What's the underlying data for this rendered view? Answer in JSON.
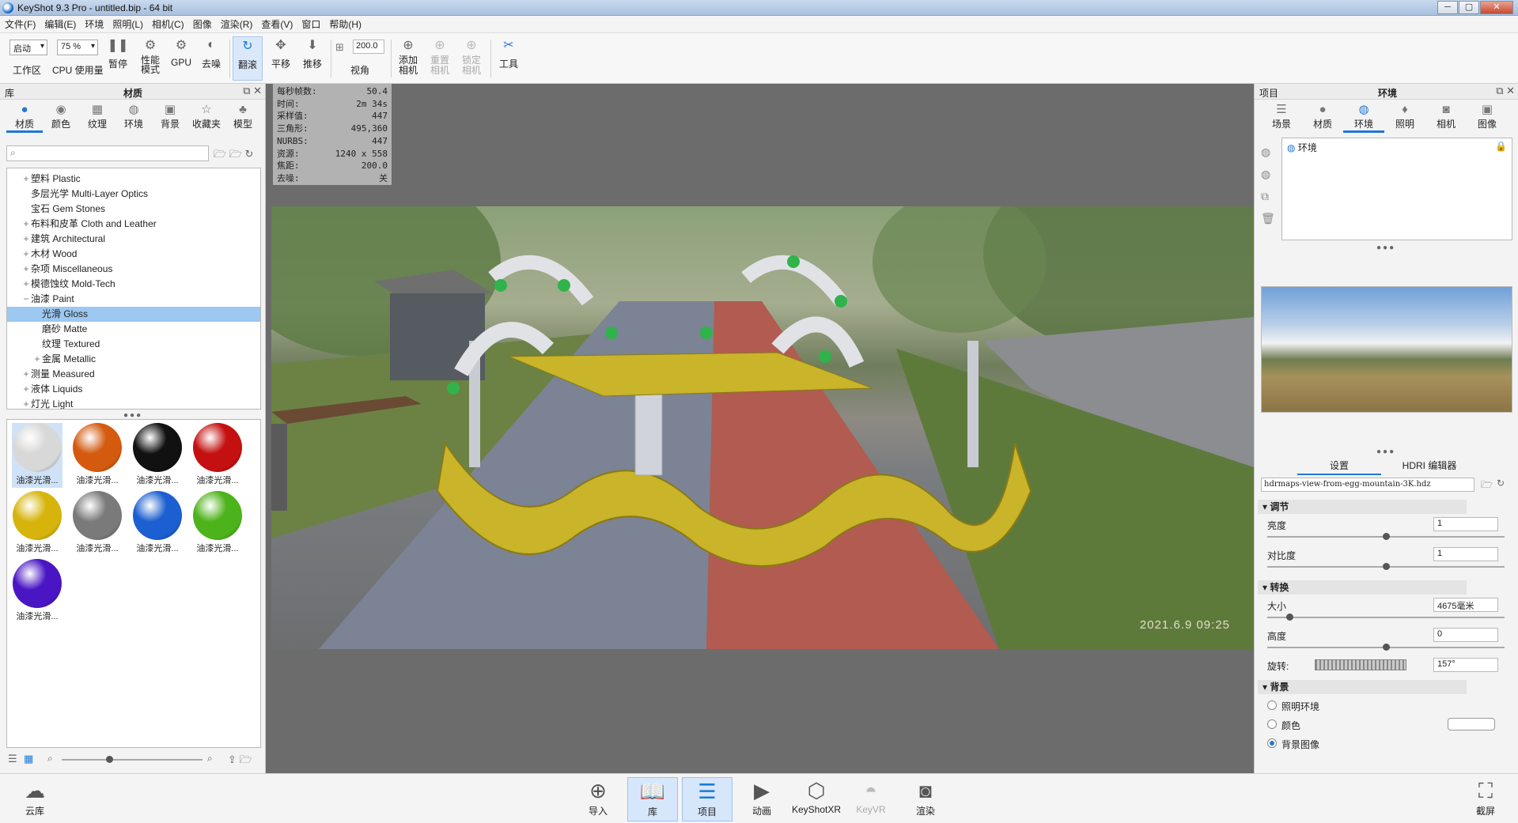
{
  "window": {
    "title": "KeyShot 9.3 Pro  - untitled.bip  - 64 bit",
    "min": "─",
    "max": "▢",
    "close": "✕"
  },
  "menu": [
    "文件(F)",
    "编辑(E)",
    "环境",
    "照明(L)",
    "相机(C)",
    "图像",
    "渲染(R)",
    "查看(V)",
    "窗口",
    "帮助(H)"
  ],
  "toolbar": {
    "workspace_select": "启动",
    "workspace_label": "工作区",
    "cpu_select": "75 %",
    "cpu_label": "CPU 使用量",
    "pause": "暂停",
    "perf": "性能\n模式",
    "gpu": "GPU",
    "denoise": "去噪",
    "tumble": "翻滚",
    "pan": "平移",
    "dolly": "推移",
    "fov_value": "200.0",
    "fov": "视角",
    "add_camera": "添加\n相机",
    "reset_camera": "重置\n相机",
    "lock_camera": "锁定\n相机",
    "tools": "工具"
  },
  "library": {
    "title_left": "库",
    "title": "材质",
    "tabs": [
      "材质",
      "颜色",
      "纹理",
      "环境",
      "背景",
      "收藏夹",
      "模型"
    ],
    "search_placeholder": "",
    "tree": [
      {
        "label": "塑料 Plastic",
        "pm": "+",
        "indent": 1
      },
      {
        "label": "多层光学 Multi-Layer Optics",
        "pm": "",
        "indent": 1
      },
      {
        "label": "宝石 Gem Stones",
        "pm": "",
        "indent": 1
      },
      {
        "label": "布料和皮革 Cloth and Leather",
        "pm": "+",
        "indent": 1
      },
      {
        "label": "建筑 Architectural",
        "pm": "+",
        "indent": 1
      },
      {
        "label": "木材 Wood",
        "pm": "+",
        "indent": 1
      },
      {
        "label": "杂项 Miscellaneous",
        "pm": "+",
        "indent": 1
      },
      {
        "label": "模德蚀纹 Mold-Tech",
        "pm": "+",
        "indent": 1
      },
      {
        "label": "油漆 Paint",
        "pm": "−",
        "indent": 1
      },
      {
        "label": "光滑 Gloss",
        "pm": "",
        "indent": 2,
        "selected": true
      },
      {
        "label": "磨砂 Matte",
        "pm": "",
        "indent": 2
      },
      {
        "label": "纹理 Textured",
        "pm": "",
        "indent": 2
      },
      {
        "label": "金属 Metallic",
        "pm": "+",
        "indent": 2
      },
      {
        "label": "测量 Measured",
        "pm": "+",
        "indent": 1
      },
      {
        "label": "液体 Liquids",
        "pm": "+",
        "indent": 1
      },
      {
        "label": "灯光 Light",
        "pm": "+",
        "indent": 1
      }
    ],
    "swatches": [
      {
        "label": "油漆光滑...",
        "color": "#d8d8d8"
      },
      {
        "label": "油漆光滑...",
        "color": "#d35a0f"
      },
      {
        "label": "油漆光滑...",
        "color": "#111111"
      },
      {
        "label": "油漆光滑...",
        "color": "#c41010"
      },
      {
        "label": "油漆光滑...",
        "color": "#d6b40c"
      },
      {
        "label": "油漆光滑...",
        "color": "#7a7a7a"
      },
      {
        "label": "油漆光滑...",
        "color": "#1c5fd0"
      },
      {
        "label": "油漆光滑...",
        "color": "#4db31a"
      },
      {
        "label": "油漆光滑...",
        "color": "#4a16c4"
      }
    ]
  },
  "stats": [
    [
      "每秒帧数:",
      "50.4"
    ],
    [
      "时间:",
      "2m 34s"
    ],
    [
      "采样值:",
      "447"
    ],
    [
      "三角形:",
      "495,360"
    ],
    [
      "NURBS:",
      "447"
    ],
    [
      "资源:",
      "1240 x 558"
    ],
    [
      "焦距:",
      "200.0"
    ],
    [
      "去噪:",
      "关"
    ]
  ],
  "viewport": {
    "timestamp": "2021.6.9 09:25"
  },
  "project": {
    "title_left": "项目",
    "title": "环境",
    "tabs": [
      "场景",
      "材质",
      "环境",
      "照明",
      "相机",
      "图像"
    ],
    "env_item": "环境",
    "subtabs": [
      "设置",
      "HDRI 编辑器"
    ],
    "hdri_file": "hdrmaps-view-from-egg-mountain-3K.hdz",
    "sections": {
      "adjust": "调节",
      "transform": "转换",
      "background": "背景"
    },
    "brightness_label": "亮度",
    "brightness": "1",
    "contrast_label": "对比度",
    "contrast": "1",
    "size_label": "大小",
    "size": "4675毫米",
    "height_label": "高度",
    "height": "0",
    "rotation_label": "旋转:",
    "rotation": "157°",
    "bg_options": [
      "照明环境",
      "颜色",
      "背景图像"
    ],
    "bg_selected": 2
  },
  "bottom": {
    "cloud": "云库",
    "buttons": [
      "导入",
      "库",
      "项目",
      "动画",
      "KeyShotXR",
      "KeyVR",
      "渲染"
    ],
    "screenshot": "截屏"
  }
}
